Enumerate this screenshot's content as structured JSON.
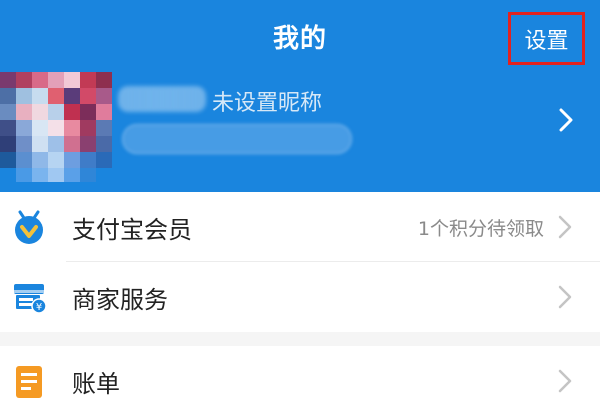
{
  "header": {
    "title": "我的",
    "settings_label": "设置",
    "background_color": "#1a85de",
    "highlight_color": "#e2221f"
  },
  "profile": {
    "nickname": "未设置昵称",
    "chevron_icon": "chevron-right-icon"
  },
  "menu": {
    "member": {
      "label": "支付宝会员",
      "extra": "1个积分待领取",
      "icon": "member-badge-icon"
    },
    "merchant": {
      "label": "商家服务",
      "icon": "merchant-store-icon"
    },
    "bill": {
      "label": "账单",
      "icon": "bill-document-icon"
    }
  }
}
